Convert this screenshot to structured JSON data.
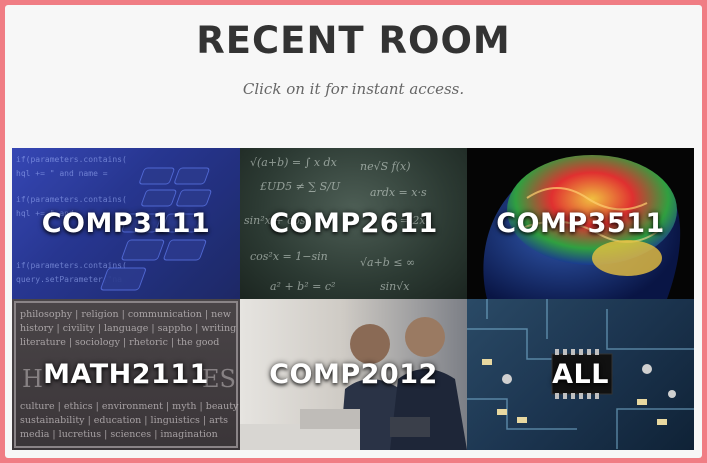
{
  "header": {
    "title": "RECENT ROOM",
    "subtitle": "Click on it for instant access."
  },
  "rooms": [
    {
      "label": "COMP3111",
      "image": "code-keyboard"
    },
    {
      "label": "COMP2611",
      "image": "chalkboard-equations"
    },
    {
      "label": "COMP3511",
      "image": "brain-scan"
    },
    {
      "label": "MATH2111",
      "image": "humanities-words"
    },
    {
      "label": "COMP2012",
      "image": "business-meeting"
    },
    {
      "label": "ALL",
      "image": "circuit-board"
    }
  ],
  "colors": {
    "frame": "#f07d84",
    "panel": "#f7f7f7",
    "title": "#333333"
  }
}
